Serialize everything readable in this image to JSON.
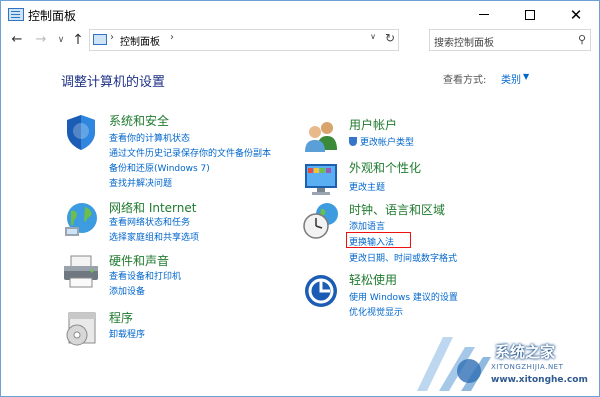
{
  "window": {
    "title": "控制面板"
  },
  "address": {
    "path": "控制面板",
    "search_placeholder": "搜索控制面板"
  },
  "main": {
    "heading": "调整计算机的设置",
    "view_by_label": "查看方式:",
    "view_by_value": "类别"
  },
  "categories": [
    {
      "title": "系统和安全",
      "links": [
        "查看你的计算机状态",
        "通过文件历史记录保存你的文件备份副本",
        "备份和还原(Windows 7)",
        "查找并解决问题"
      ]
    },
    {
      "title": "网络和 Internet",
      "links": [
        "查看网络状态和任务",
        "选择家庭组和共享选项"
      ]
    },
    {
      "title": "硬件和声音",
      "links": [
        "查看设备和打印机",
        "添加设备"
      ]
    },
    {
      "title": "程序",
      "links": [
        "卸载程序"
      ]
    },
    {
      "title": "用户帐户",
      "links": [
        "更改帐户类型"
      ]
    },
    {
      "title": "外观和个性化",
      "links": [
        "更改主题"
      ]
    },
    {
      "title": "时钟、语言和区域",
      "links": [
        "添加语言",
        "更换输入法",
        "更改日期、时间或数字格式"
      ]
    },
    {
      "title": "轻松使用",
      "links": [
        "使用 Windows 建议的设置",
        "优化视觉显示"
      ]
    }
  ],
  "watermark": {
    "name": "系统之家",
    "pinyin": "XITONGZHIJIA.NET",
    "url": "www.xitonghe.com"
  },
  "colors": {
    "link": "#0066cc",
    "category_title": "#1f7a2e",
    "heading": "#1e3287",
    "highlight": "#e11111"
  }
}
